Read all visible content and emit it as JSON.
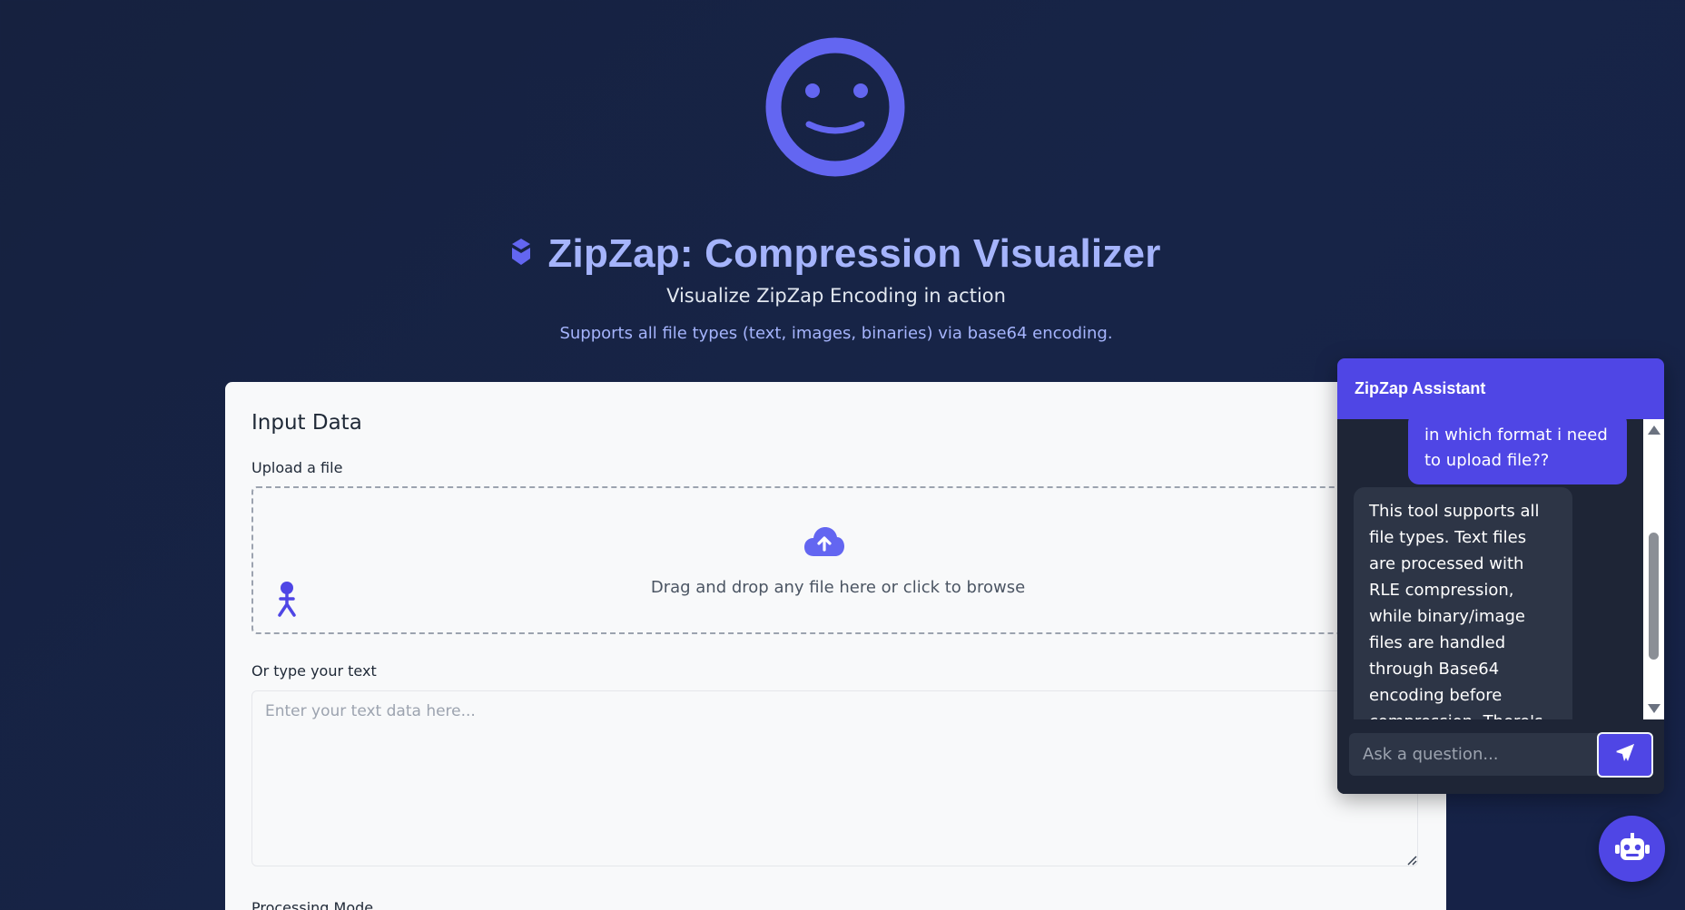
{
  "header": {
    "logo_icon": "smiley-face-icon",
    "title_icon": "layers-icon",
    "title": "ZipZap: Compression Visualizer",
    "subtitle": "Visualize ZipZap Encoding in action",
    "note": "Supports all file types (text, images, binaries) via base64 encoding."
  },
  "input_card": {
    "heading": "Input Data",
    "upload_label": "Upload a file",
    "dropzone_icon": "cloud-upload-icon",
    "dropzone_text": "Drag and drop any file here or click to browse",
    "text_label": "Or type your text",
    "text_placeholder": "Enter your text data here...",
    "text_value": "",
    "mode_label": "Processing Mode"
  },
  "chat": {
    "title": "ZipZap Assistant",
    "messages": [
      {
        "role": "user",
        "text": "in which format i need to upload file??"
      },
      {
        "role": "bot",
        "text": "This tool supports all file types. Text files are processed with RLE compression, while binary/image files are handled through Base64 encoding before compression. There's no file size limit, but larger"
      }
    ],
    "input_placeholder": "Ask a question...",
    "send_icon": "paper-plane-icon"
  },
  "fab": {
    "icon": "robot-icon"
  },
  "colors": {
    "accent": "#4f46e5",
    "title": "#a5b4fc",
    "background": "#16213f"
  }
}
